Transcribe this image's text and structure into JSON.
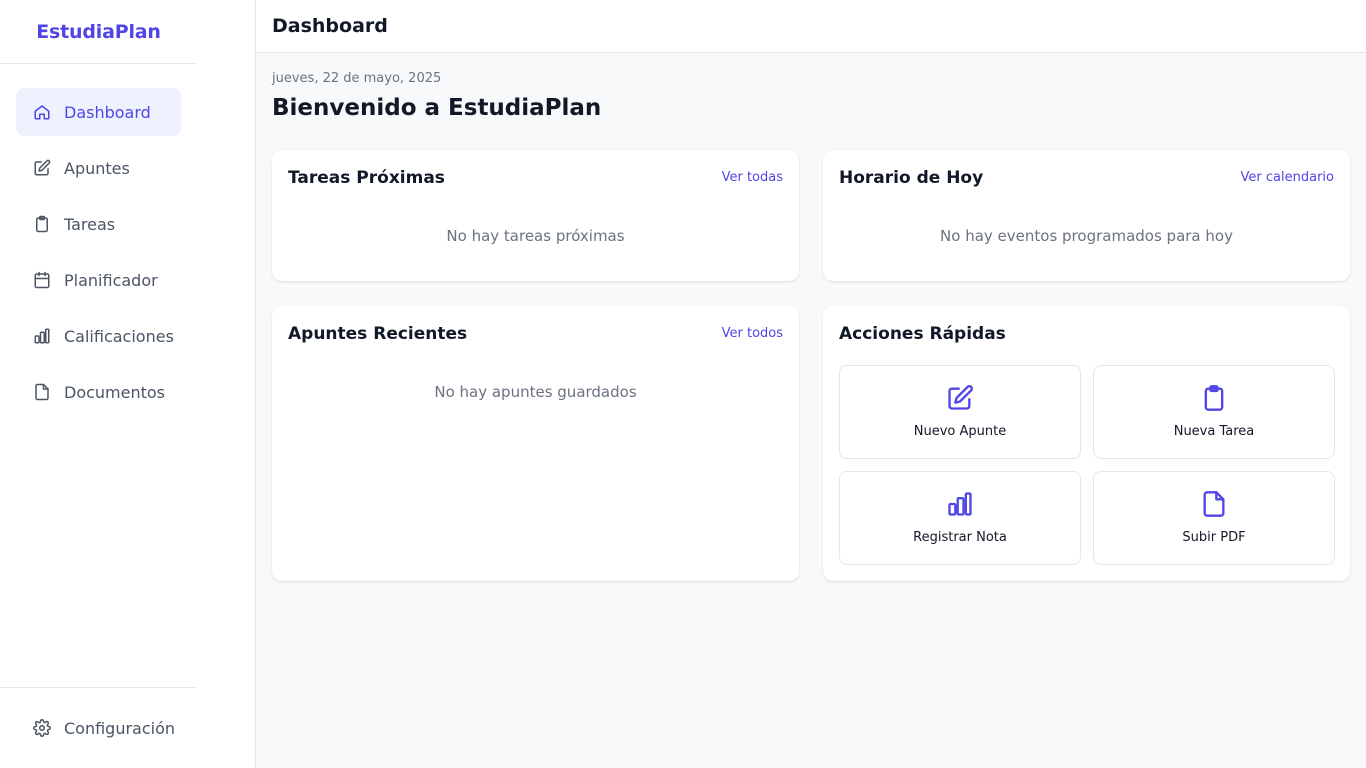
{
  "app": {
    "brand": "EstudiaPlan"
  },
  "sidebar": {
    "items": [
      {
        "label": "Dashboard",
        "icon": "home-icon",
        "active": true
      },
      {
        "label": "Apuntes",
        "icon": "edit-icon"
      },
      {
        "label": "Tareas",
        "icon": "clipboard-icon"
      },
      {
        "label": "Planificador",
        "icon": "calendar-icon"
      },
      {
        "label": "Calificaciones",
        "icon": "bar-chart-icon"
      },
      {
        "label": "Documentos",
        "icon": "file-icon"
      }
    ],
    "settings": {
      "label": "Configuración",
      "icon": "gear-icon"
    }
  },
  "header": {
    "title": "Dashboard"
  },
  "main": {
    "date": "jueves, 22 de mayo, 2025",
    "welcome": "Bienvenido a EstudiaPlan",
    "upcoming_tasks": {
      "title": "Tareas Próximas",
      "link": "Ver todas",
      "empty": "No hay tareas próximas"
    },
    "schedule": {
      "title": "Horario de Hoy",
      "link": "Ver calendario",
      "empty": "No hay eventos programados para hoy"
    },
    "recent_notes": {
      "title": "Apuntes Recientes",
      "link": "Ver todos",
      "empty": "No hay apuntes guardados"
    },
    "quick_actions": {
      "title": "Acciones Rápidas",
      "items": [
        {
          "label": "Nuevo Apunte",
          "icon": "edit-icon"
        },
        {
          "label": "Nueva Tarea",
          "icon": "clipboard-icon"
        },
        {
          "label": "Registrar Nota",
          "icon": "bar-chart-icon"
        },
        {
          "label": "Subir PDF",
          "icon": "file-icon"
        }
      ]
    }
  },
  "colors": {
    "accent": "#4f46e5",
    "active_bg": "#eef2ff",
    "muted_text": "#6b7280",
    "page_bg": "#f8f9fb"
  }
}
